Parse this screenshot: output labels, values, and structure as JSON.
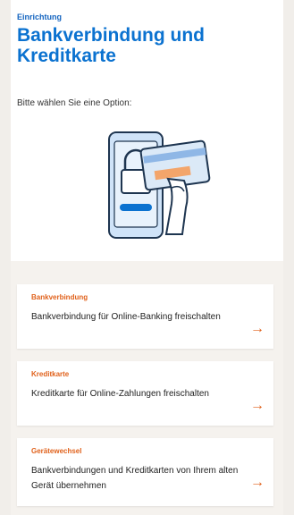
{
  "header": {
    "kicker": "Einrichtung",
    "title": "Bankverbindung und Kreditkarte"
  },
  "prompt": "Bitte wählen Sie eine Option:",
  "options": [
    {
      "kicker": "Bankverbindung",
      "text": "Bankverbindung für Online-Banking freischalten",
      "arrow": "→"
    },
    {
      "kicker": "Kreditkarte",
      "text": "Kreditkarte für Online-Zahlungen freischalten",
      "arrow": "→"
    },
    {
      "kicker": "Gerätewechsel",
      "text": "Bankverbindungen und Kreditkarten von Ihrem alten Gerät übernehmen",
      "arrow": "→"
    }
  ],
  "colors": {
    "accent_blue": "#0b72d0",
    "accent_orange": "#e0611b",
    "illustration_blue": "#b9d6f5"
  }
}
